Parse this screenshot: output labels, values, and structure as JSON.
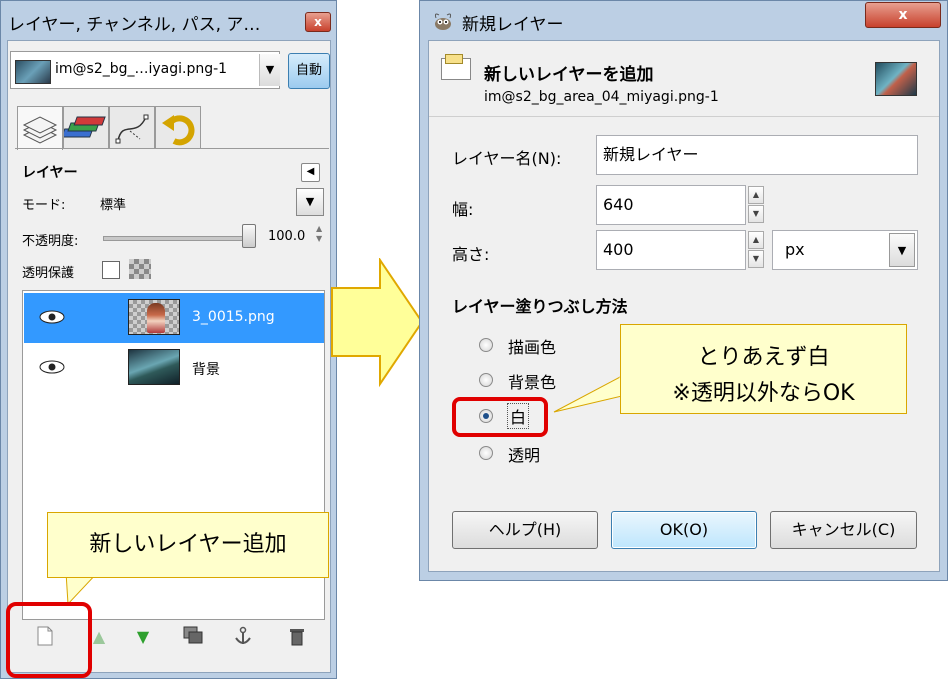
{
  "layers_window": {
    "title": "レイヤー, チャンネル, パス, ア…",
    "close_label": "x",
    "image_combo": "im@s2_bg_…iyagi.png-1",
    "auto_button": "自動",
    "layers_header": "レイヤー",
    "mode_label": "モード:",
    "mode_value": "標準",
    "opacity_label": "不透明度:",
    "opacity_value": "100.0",
    "lock_label": "透明保護",
    "layers": [
      {
        "name": "3_0015.png",
        "selected": true
      },
      {
        "name": "背景",
        "selected": false
      }
    ]
  },
  "callout_new_layer": "新しいレイヤー追加",
  "dialog": {
    "title": "新規レイヤー",
    "close_label": "x",
    "header_title": "新しいレイヤーを追加",
    "header_subtitle": "im@s2_bg_area_04_miyagi.png-1",
    "layer_name_label": "レイヤー名(N):",
    "layer_name_value": "新規レイヤー",
    "width_label": "幅:",
    "width_value": "640",
    "height_label": "高さ:",
    "height_value": "400",
    "unit_value": "px",
    "fill_header": "レイヤー塗りつぶし方法",
    "fill_options": [
      {
        "label": "描画色",
        "checked": false
      },
      {
        "label": "背景色",
        "checked": false
      },
      {
        "label": "白",
        "checked": true
      },
      {
        "label": "透明",
        "checked": false
      }
    ],
    "help_button": "ヘルプ(H)",
    "ok_button": "OK(O)",
    "cancel_button": "キャンセル(C)"
  },
  "callout_white": {
    "line1": "とりあえず白",
    "line2": "※透明以外ならOK"
  },
  "colors": {
    "selection": "#3399ff",
    "highlight_red": "#e00000",
    "callout_fill": "#ffffcc",
    "arrow_fill": "#ffff99"
  }
}
